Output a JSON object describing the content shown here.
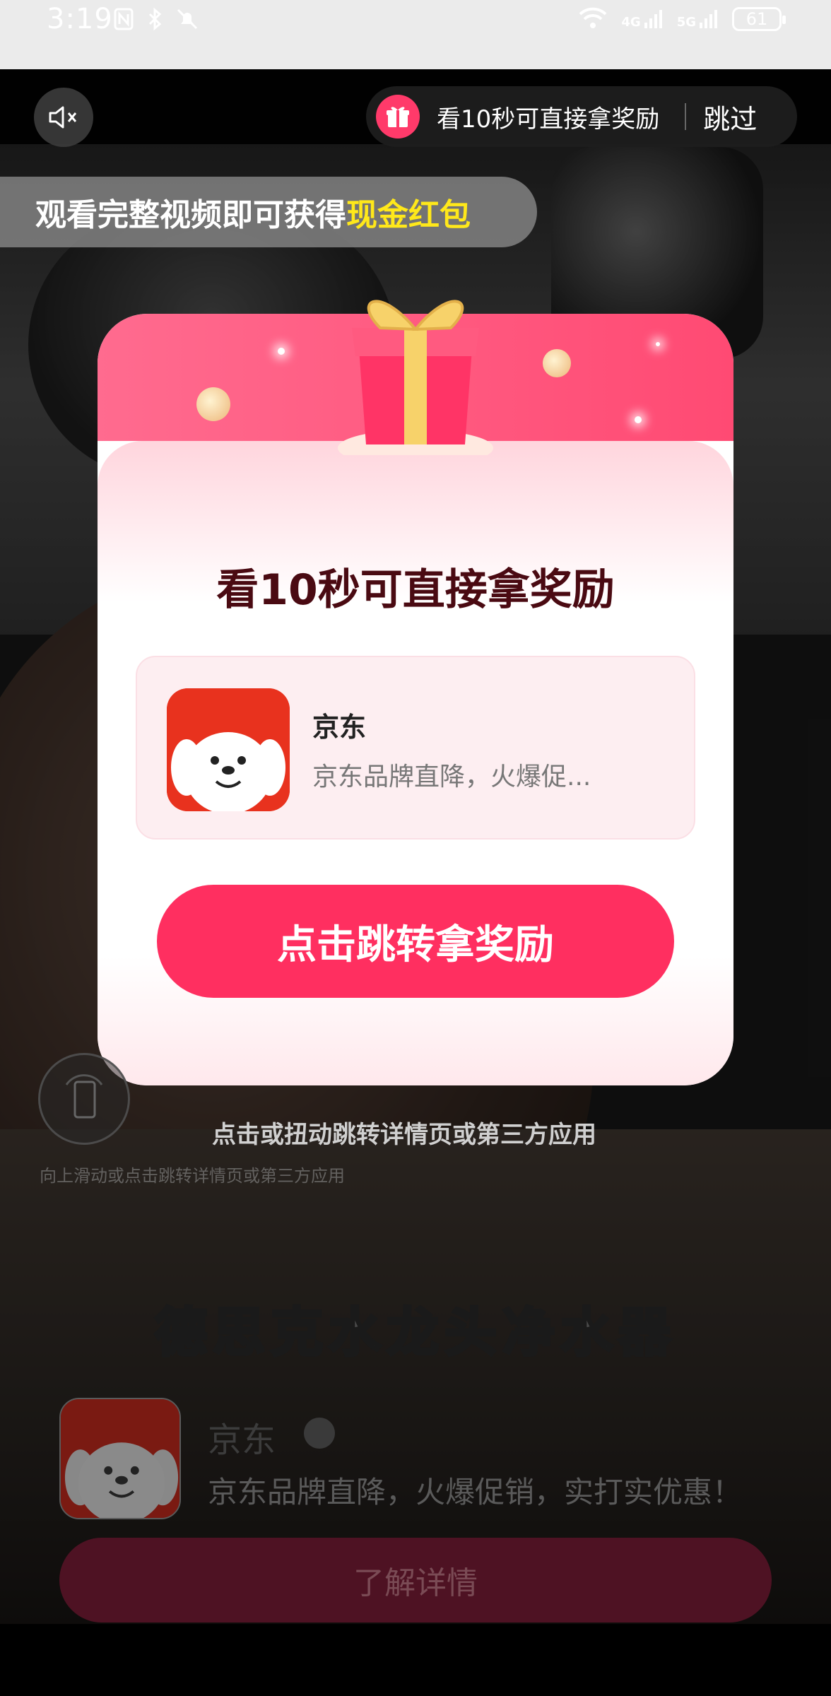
{
  "status_bar": {
    "time": "3:19",
    "battery": "61",
    "network_1": "4G",
    "network_2": "5G"
  },
  "ad_top": {
    "reward_text": "看10秒可直接拿奖励",
    "skip_label": "跳过",
    "banner_prefix": "观看完整视频即可获得",
    "banner_highlight": "现金红包"
  },
  "modal": {
    "title": "看10秒可直接拿奖励",
    "app_name": "京东",
    "app_desc": "京东品牌直降，火爆促...",
    "cta_label": "点击跳转拿奖励"
  },
  "hints": {
    "primary": "点击或扭动跳转详情页或第三方应用",
    "secondary": "向上滑动或点击跳转详情页或第三方应用"
  },
  "ad_footer": {
    "video_title": "德思克水龙头净水器",
    "app_name": "京东",
    "desc": "京东品牌直降，火爆促销，实打实优惠！",
    "button_label": "了解详情"
  },
  "colors": {
    "accent": "#ff2f60",
    "highlight": "#ffe81a",
    "title_text": "#4a0a12"
  }
}
